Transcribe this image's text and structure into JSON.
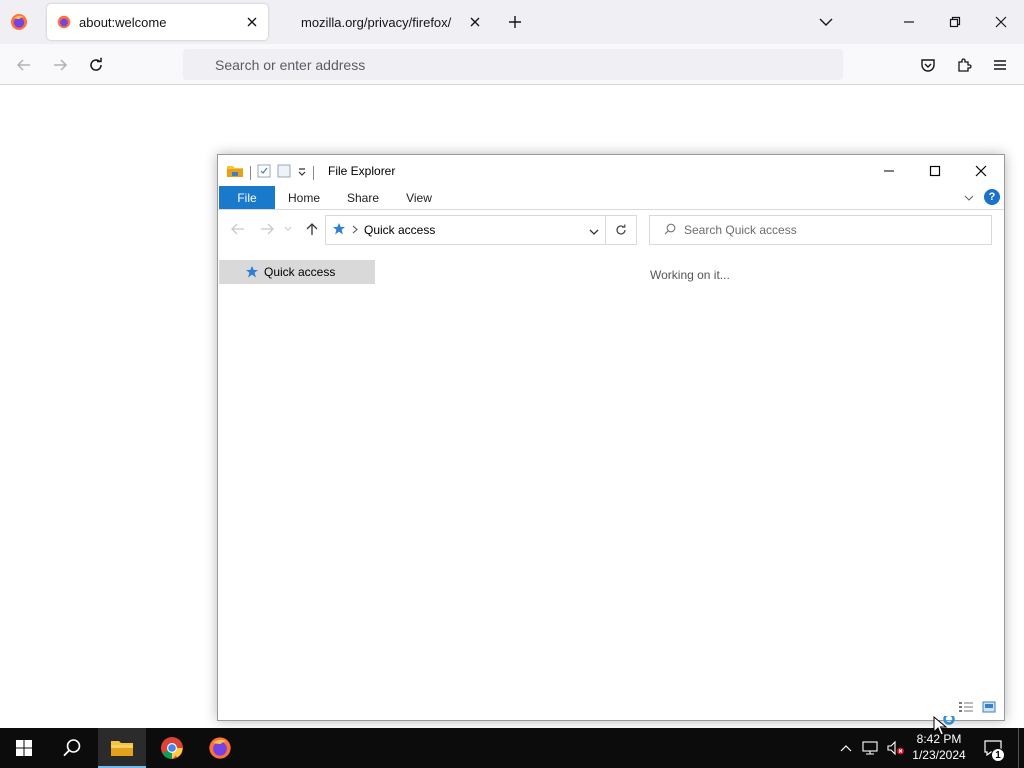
{
  "firefox": {
    "tabs": [
      {
        "label": "about:welcome",
        "active": true
      },
      {
        "label": "mozilla.org/privacy/firefox/",
        "active": false
      }
    ],
    "url_placeholder": "Search or enter address",
    "icons": {
      "app_menu": "firefox-icon",
      "back": "arrow-left-icon",
      "forward": "arrow-right-icon",
      "reload": "reload-icon",
      "pocket": "pocket-icon",
      "extensions": "puzzle-icon",
      "menu": "hamburger-icon"
    }
  },
  "explorer": {
    "title": "File Explorer",
    "ribbon_tabs": [
      "File",
      "Home",
      "Share",
      "View"
    ],
    "address_crumb": "Quick access",
    "search_placeholder": "Search Quick access",
    "nav_items": [
      {
        "label": "Quick access",
        "selected": true
      }
    ],
    "status_text": "Working on it...",
    "help_label": "?"
  },
  "taskbar": {
    "apps": [
      "start",
      "search",
      "file-explorer",
      "chrome",
      "firefox"
    ],
    "active_app": "file-explorer",
    "time": "8:42 PM",
    "date": "1/23/2024",
    "notification_count": "1"
  },
  "colors": {
    "firefox_tabstrip": "#f0f0f4",
    "explorer_file_tab": "#1979ca",
    "taskbar": "#0c0c0c",
    "accent": "#76b9ed"
  }
}
